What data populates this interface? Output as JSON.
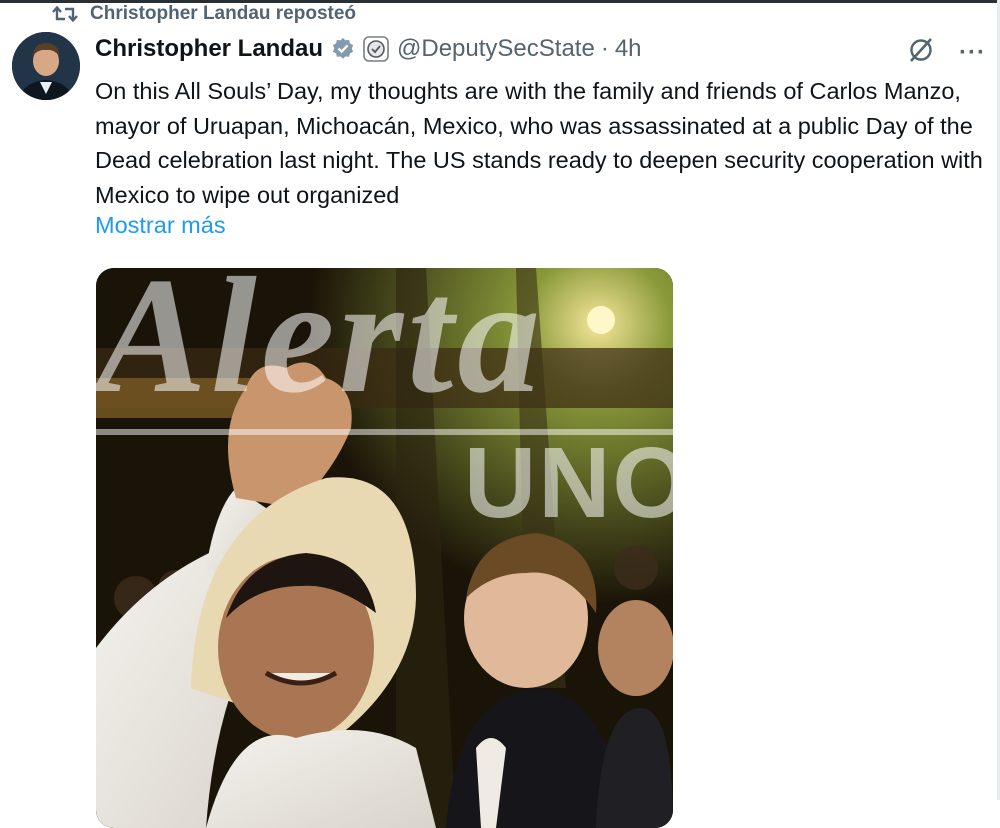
{
  "repost": {
    "label": "Christopher Landau reposteó"
  },
  "tweet": {
    "author_name": "Christopher Landau",
    "handle": "@DeputySecState",
    "separator": "·",
    "time": "4h",
    "text": "On this All Souls’ Day, my thoughts are with the family and friends of Carlos Manzo, mayor of Uruapan, Michoacán, Mexico, who was assassinated at a public Day of the Dead celebration last night. The US stands ready to deepen security cooperation with Mexico to wipe out organized",
    "show_more": "Mostrar más",
    "more_menu": "···"
  },
  "watermark": {
    "script": "Alerta",
    "block": "UNO"
  },
  "colors": {
    "accent": "#1d9bf0",
    "muted": "#536471",
    "text": "#0f1419"
  },
  "icons": [
    "repost-icon",
    "verified-badge-icon",
    "affiliation-badge-icon",
    "grok-icon",
    "more-icon"
  ]
}
